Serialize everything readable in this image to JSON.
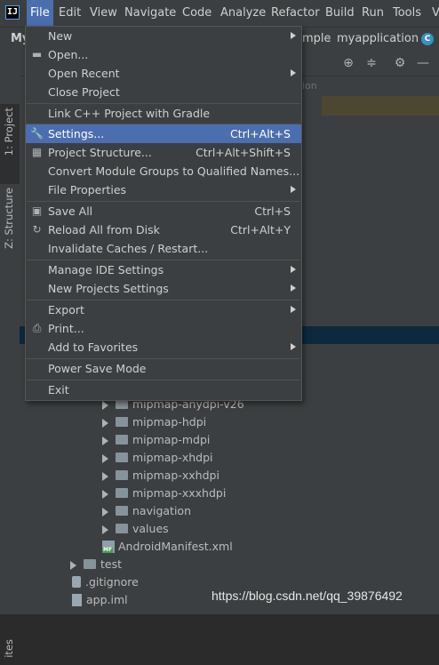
{
  "menubar": {
    "items": [
      "File",
      "Edit",
      "View",
      "Navigate",
      "Code",
      "Analyze",
      "Refactor",
      "Build",
      "Run",
      "Tools",
      "V"
    ],
    "active": "File",
    "app_icon_glyph": "IJ"
  },
  "navbar": {
    "project_fragment": "My",
    "crumb_1": "mple",
    "crumb_2": "myapplication",
    "class_icon": "C"
  },
  "tool_strip": {
    "project_tab": "1: Project",
    "structure_tab": "Z: Structure",
    "bottom_tab": "ites"
  },
  "tree": {
    "hint": "ion",
    "rows": [
      {
        "label": "mipmap-anydpi-v26",
        "kind": "folder"
      },
      {
        "label": "mipmap-hdpi",
        "kind": "folder"
      },
      {
        "label": "mipmap-mdpi",
        "kind": "folder"
      },
      {
        "label": "mipmap-xhdpi",
        "kind": "folder"
      },
      {
        "label": "mipmap-xxhdpi",
        "kind": "folder"
      },
      {
        "label": "mipmap-xxxhdpi",
        "kind": "folder"
      },
      {
        "label": "navigation",
        "kind": "folder"
      },
      {
        "label": "values",
        "kind": "folder"
      },
      {
        "label": "AndroidManifest.xml",
        "kind": "xml"
      },
      {
        "label": "test",
        "kind": "folder"
      },
      {
        "label": ".gitignore",
        "kind": "git"
      },
      {
        "label": "app.iml",
        "kind": "file"
      }
    ],
    "xml_badge": "MF"
  },
  "file_menu": {
    "items": [
      {
        "label": "New",
        "shortcut": "",
        "submenu": true
      },
      {
        "label": "Open...",
        "shortcut": "",
        "icon": "folder-open-icon"
      },
      {
        "label": "Open Recent",
        "shortcut": "",
        "submenu": true
      },
      {
        "label": "Close Project",
        "shortcut": ""
      },
      {
        "label": "Link C++ Project with Gradle",
        "shortcut": ""
      },
      {
        "label": "Settings...",
        "shortcut": "Ctrl+Alt+S",
        "icon": "wrench-icon",
        "selected": true
      },
      {
        "label": "Project Structure...",
        "shortcut": "Ctrl+Alt+Shift+S",
        "icon": "project-structure-icon"
      },
      {
        "label": "Convert Module Groups to Qualified Names...",
        "shortcut": ""
      },
      {
        "label": "File Properties",
        "shortcut": "",
        "submenu": true
      },
      {
        "label": "Save All",
        "shortcut": "Ctrl+S",
        "icon": "save-icon"
      },
      {
        "label": "Reload All from Disk",
        "shortcut": "Ctrl+Alt+Y",
        "icon": "reload-icon"
      },
      {
        "label": "Invalidate Caches / Restart...",
        "shortcut": ""
      },
      {
        "label": "Manage IDE Settings",
        "shortcut": "",
        "submenu": true
      },
      {
        "label": "New Projects Settings",
        "shortcut": "",
        "submenu": true
      },
      {
        "label": "Export",
        "shortcut": "",
        "submenu": true
      },
      {
        "label": "Print...",
        "shortcut": "",
        "icon": "print-icon"
      },
      {
        "label": "Add to Favorites",
        "shortcut": "",
        "submenu": true
      },
      {
        "label": "Power Save Mode",
        "shortcut": ""
      },
      {
        "label": "Exit",
        "shortcut": ""
      }
    ]
  },
  "watermark": "https://blog.csdn.net/qq_39876492",
  "colors": {
    "menu_bg": "#3c3f41",
    "selection": "#4b6eaf",
    "editor_bg": "#2b2b2b"
  }
}
